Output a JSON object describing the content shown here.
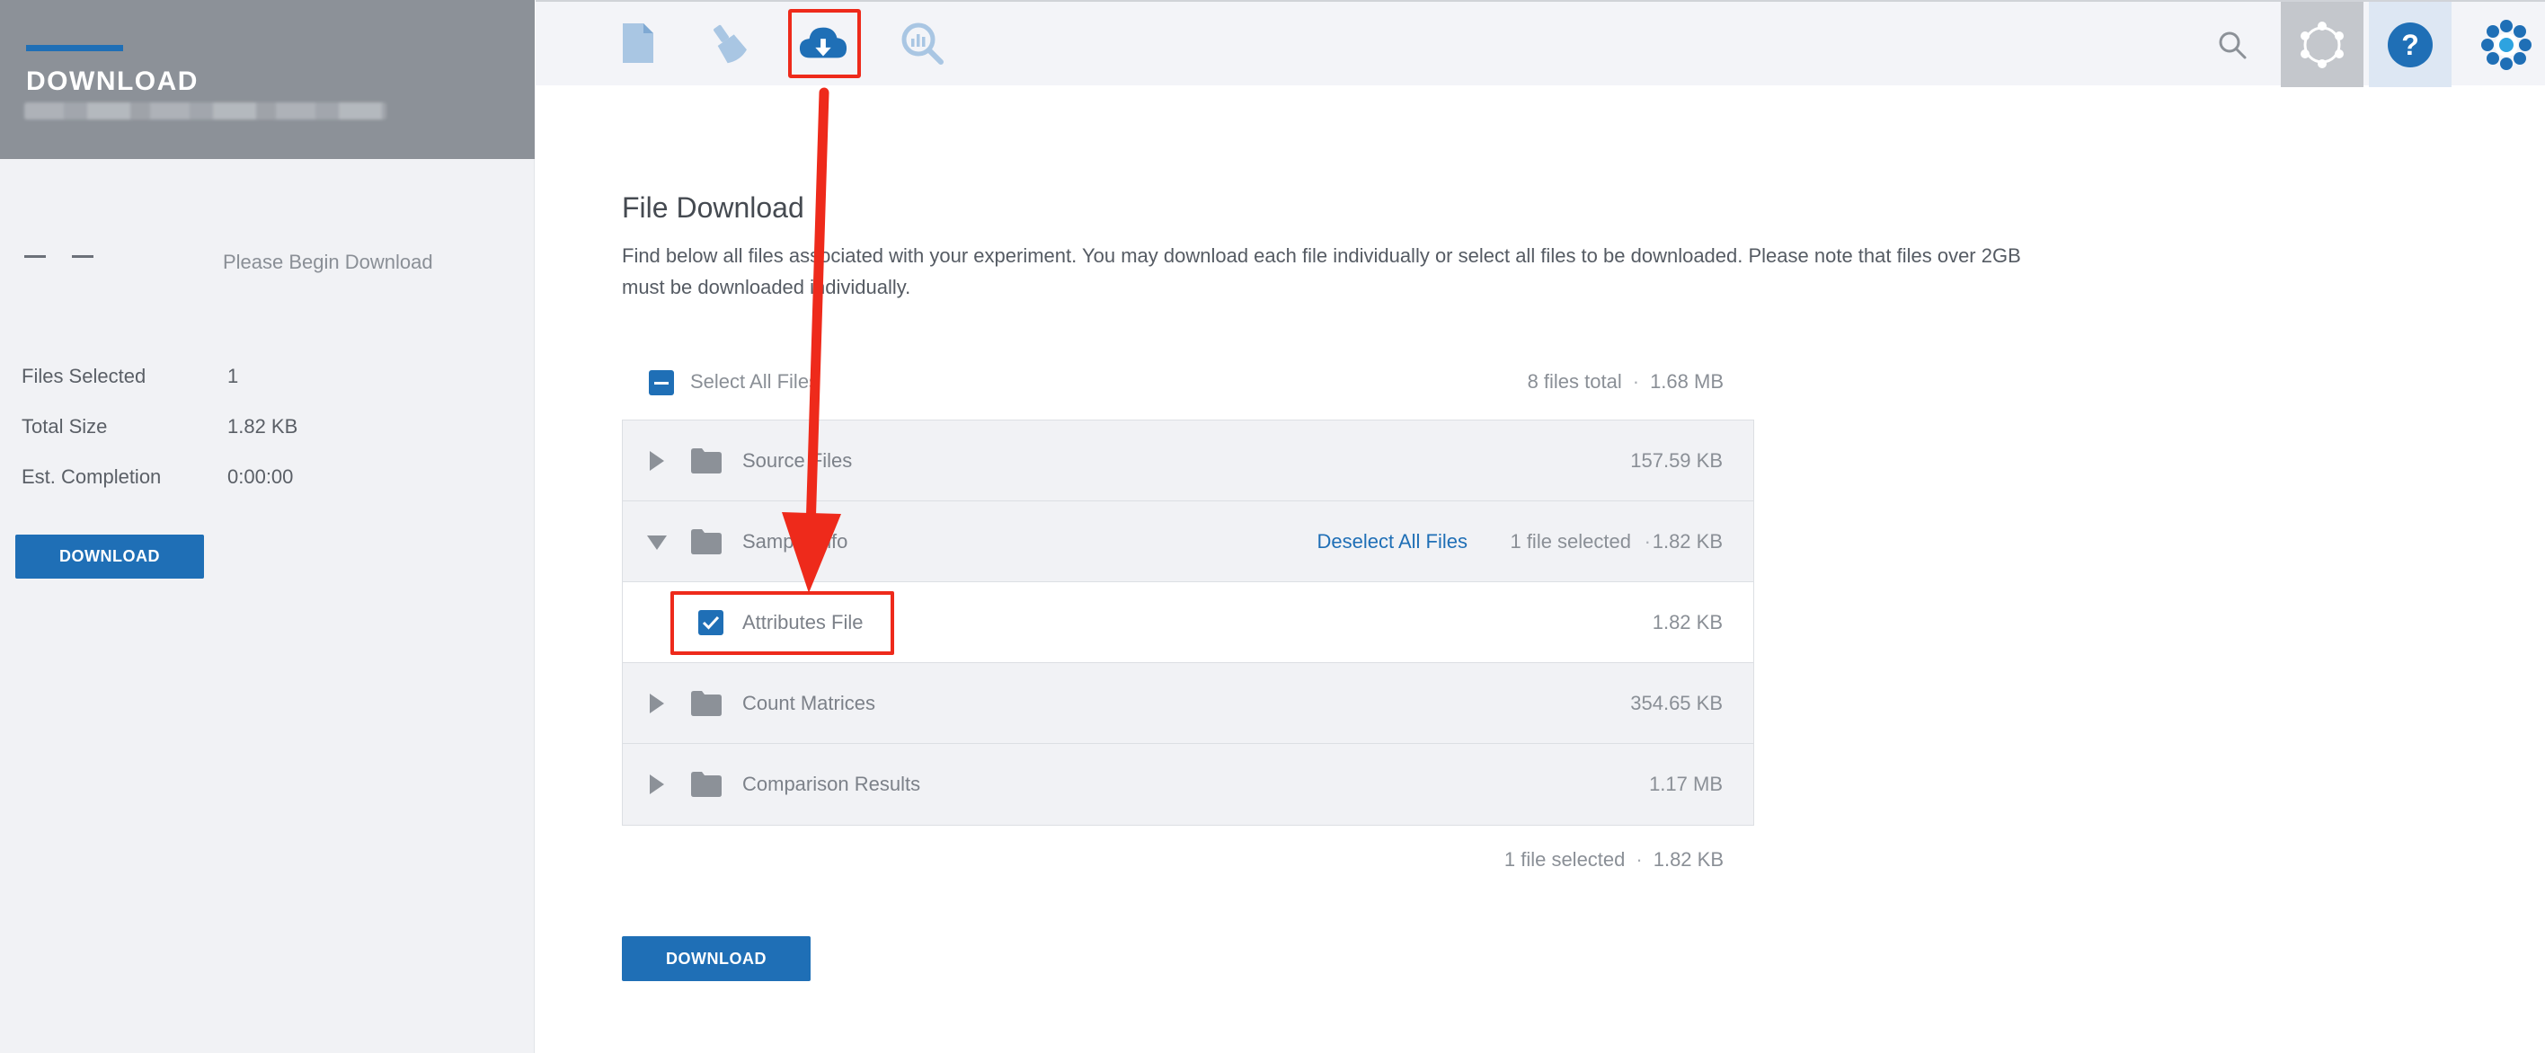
{
  "sidebar": {
    "title": "DOWNLOAD",
    "status": "Please Begin Download",
    "stats": [
      {
        "label": "Files Selected",
        "value": "1"
      },
      {
        "label": "Total Size",
        "value": "1.82 KB"
      },
      {
        "label": "Est. Completion",
        "value": "0:00:00"
      }
    ],
    "download_label": "DOWNLOAD"
  },
  "topbar": {
    "icons": [
      "document-icon",
      "flask-icon",
      "cloud-download-icon",
      "analysis-search-icon"
    ],
    "active_icon": "cloud-download-icon",
    "right_icons": [
      "search-icon",
      "settings-network-icon",
      "help-icon",
      "logo-icon"
    ]
  },
  "main": {
    "heading": "File Download",
    "description": "Find below all files associated with your experiment. You may download each file individually or select all files to be downloaded. Please note that files over 2GB must be downloaded individually.",
    "select_all_label": "Select All Files",
    "total_files": "8 files total",
    "total_size": "1.68 MB",
    "rows": [
      {
        "type": "folder",
        "label": "Source Files",
        "size": "157.59 KB",
        "expanded": false
      },
      {
        "type": "folder",
        "label": "Sample Info",
        "size": "1.82 KB",
        "expanded": true,
        "deselect_label": "Deselect All Files",
        "selected_text": "1 file selected"
      },
      {
        "type": "file",
        "label": "Attributes File",
        "size": "1.82 KB",
        "checked": true
      },
      {
        "type": "folder",
        "label": "Count Matrices",
        "size": "354.65 KB",
        "expanded": false
      },
      {
        "type": "folder",
        "label": "Comparison Results",
        "size": "1.17 MB",
        "expanded": false
      }
    ],
    "bottom_selected": "1 file selected",
    "bottom_size": "1.82 KB",
    "download_label": "DOWNLOAD"
  },
  "colors": {
    "accent": "#1f6fb6",
    "annotation": "#ee2a1b",
    "sidebar_header": "#8c9198"
  }
}
